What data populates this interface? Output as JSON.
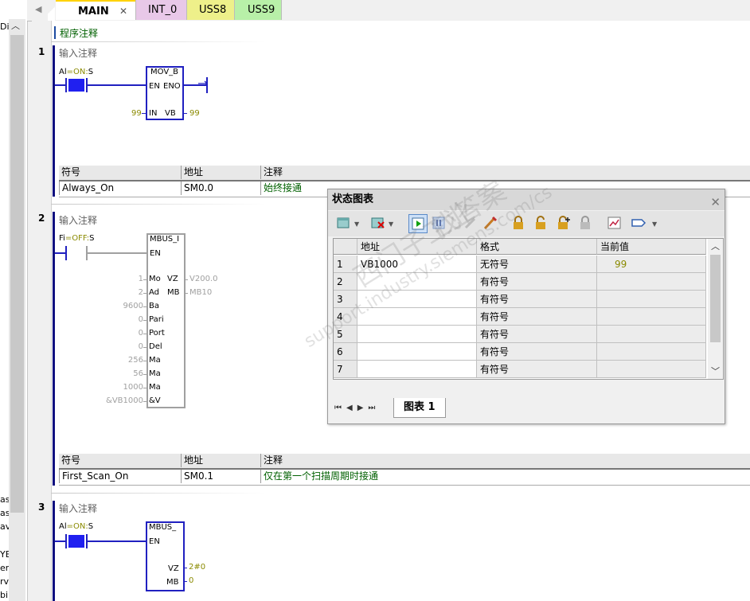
{
  "tabs": [
    {
      "label": "MAIN",
      "color": "#f0f0f0",
      "active": true,
      "close": "✕"
    },
    {
      "label": "INT_0",
      "color": "#e8c8e8"
    },
    {
      "label": "USS8",
      "color": "#eef08a"
    },
    {
      "label": "USS9",
      "color": "#b8f0a8"
    }
  ],
  "left_panel": {
    "top_fragment": "Di",
    "fragments": [
      "as",
      "as",
      "av",
      "YE",
      "er",
      "rv",
      "bi"
    ]
  },
  "program_comment": "程序注释",
  "networks": [
    {
      "number": "1",
      "comment": "输入注释",
      "contact_label_prefix": "Al",
      "contact_state": "=ON:",
      "contact_label_suffix": "S",
      "box_title": "MOV_B",
      "pins": {
        "en": "EN",
        "eno": "ENO",
        "in": "IN",
        "out": "VB"
      },
      "in_value": "99",
      "out_value": "99",
      "symbols": {
        "headers": [
          "符号",
          "地址",
          "注释"
        ],
        "row": {
          "symbol": "Always_On",
          "address": "SM0.0",
          "comment": "始终接通"
        }
      }
    },
    {
      "number": "2",
      "comment": "输入注释",
      "contact_label_prefix": "Fi",
      "contact_state": "=OFF:",
      "contact_label_suffix": "S",
      "box_title": "MBUS_I",
      "en": "EN",
      "inputs": [
        {
          "value": "1",
          "pin": "Mo"
        },
        {
          "value": "2",
          "pin": "Ad"
        },
        {
          "value": "9600",
          "pin": "Ba"
        },
        {
          "value": "0",
          "pin": "Pari"
        },
        {
          "value": "0",
          "pin": "Port"
        },
        {
          "value": "0",
          "pin": "Del"
        },
        {
          "value": "256",
          "pin": "Ma"
        },
        {
          "value": "56",
          "pin": "Ma"
        },
        {
          "value": "1000",
          "pin": "Ma"
        },
        {
          "value": "&VB1000",
          "pin": "&V"
        }
      ],
      "outputs": [
        {
          "pin": "VZ",
          "value": "V200.0"
        },
        {
          "pin": "MB",
          "value": "MB10"
        }
      ],
      "symbols": {
        "headers": [
          "符号",
          "地址",
          "注释"
        ],
        "row": {
          "symbol": "First_Scan_On",
          "address": "SM0.1",
          "comment": "仅在第一个扫描周期时接通"
        }
      }
    },
    {
      "number": "3",
      "comment": "输入注释",
      "contact_label_prefix": "Al",
      "contact_state": "=ON:",
      "contact_label_suffix": "S",
      "box_title": "MBUS_",
      "en": "EN",
      "outputs": [
        {
          "pin": "VZ",
          "value": "2#0"
        },
        {
          "pin": "MB",
          "value": "0"
        }
      ]
    }
  ],
  "status_chart": {
    "title": "状态图表",
    "close": "✕",
    "columns": [
      "地址",
      "格式",
      "当前值"
    ],
    "rows": [
      {
        "n": "1",
        "address": "VB1000",
        "format": "无符号",
        "value": "99"
      },
      {
        "n": "2",
        "address": "",
        "format": "有符号",
        "value": ""
      },
      {
        "n": "3",
        "address": "",
        "format": "有符号",
        "value": ""
      },
      {
        "n": "4",
        "address": "",
        "format": "有符号",
        "value": ""
      },
      {
        "n": "5",
        "address": "",
        "format": "有符号",
        "value": ""
      },
      {
        "n": "6",
        "address": "",
        "format": "有符号",
        "value": ""
      },
      {
        "n": "7",
        "address": "",
        "format": "有符号",
        "value": ""
      }
    ],
    "sheet_tab": "图表 1",
    "watermark_lines": [
      "西门子工业",
      "找答案",
      "support.industry.siemens.com/cs"
    ]
  },
  "colors": {
    "rung_wire": "#2020c0",
    "rail": "#101080",
    "value_olive": "#8a8a00",
    "comment_green": "#006000"
  }
}
